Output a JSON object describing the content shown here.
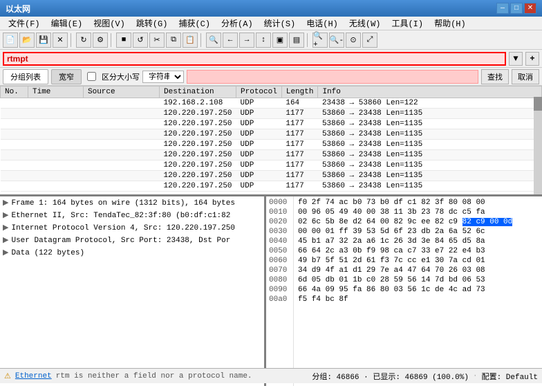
{
  "title": "以太网",
  "titlebar": {
    "title": "以太网",
    "minimize": "—",
    "maximize": "□",
    "close": "✕"
  },
  "menu": {
    "items": [
      "文件(F)",
      "编辑(E)",
      "视图(V)",
      "跳转(G)",
      "捕获(C)",
      "分析(A)",
      "统计(S)",
      "电话(H)",
      "无线(W)",
      "工具(I)",
      "帮助(H)"
    ]
  },
  "filter": {
    "value": "rtmpt",
    "placeholder": ""
  },
  "filter_row2": {
    "tab1": "分组列表",
    "tab2": "宽窄",
    "checkbox_label": "区分大小写",
    "select_label": "字符串",
    "search_btn": "查找",
    "cancel_btn": "取消"
  },
  "table": {
    "headers": [
      "No.",
      "Time",
      "Source",
      "Destination",
      "Protocol",
      "Length",
      "Info"
    ],
    "rows": [
      {
        "no": "",
        "time": "",
        "src": "",
        "dst": "192.168.2.108",
        "proto": "UDP",
        "len": "164",
        "info": "23438 → 53860  Len=122"
      },
      {
        "no": "",
        "time": "",
        "src": "",
        "dst": "120.220.197.250",
        "proto": "UDP",
        "len": "1177",
        "info": "53860 → 23438  Len=1135"
      },
      {
        "no": "",
        "time": "",
        "src": "",
        "dst": "120.220.197.250",
        "proto": "UDP",
        "len": "1177",
        "info": "53860 → 23438  Len=1135"
      },
      {
        "no": "",
        "time": "",
        "src": "",
        "dst": "120.220.197.250",
        "proto": "UDP",
        "len": "1177",
        "info": "53860 → 23438  Len=1135"
      },
      {
        "no": "",
        "time": "",
        "src": "",
        "dst": "120.220.197.250",
        "proto": "UDP",
        "len": "1177",
        "info": "53860 → 23438  Len=1135"
      },
      {
        "no": "",
        "time": "",
        "src": "",
        "dst": "120.220.197.250",
        "proto": "UDP",
        "len": "1177",
        "info": "53860 → 23438  Len=1135"
      },
      {
        "no": "",
        "time": "",
        "src": "",
        "dst": "120.220.197.250",
        "proto": "UDP",
        "len": "1177",
        "info": "53860 → 23438  Len=1135"
      },
      {
        "no": "",
        "time": "",
        "src": "",
        "dst": "120.220.197.250",
        "proto": "UDP",
        "len": "1177",
        "info": "53860 → 23438  Len=1135"
      },
      {
        "no": "",
        "time": "",
        "src": "",
        "dst": "120.220.197.250",
        "proto": "UDP",
        "len": "1177",
        "info": "53860 → 23438  Len=1135"
      }
    ]
  },
  "detail": {
    "items": [
      {
        "text": "Frame 1: 164 bytes on wire (1312 bits), 164 bytes",
        "arrow": "▶",
        "expandable": true
      },
      {
        "text": "Ethernet II, Src: TendaTec_82:3f:80 (b0:df:c1:82",
        "arrow": "▶",
        "expandable": true
      },
      {
        "text": "Internet Protocol Version 4, Src: 120.220.197.250",
        "arrow": "▶",
        "expandable": true
      },
      {
        "text": "User Datagram Protocol, Src Port: 23438, Dst Por",
        "arrow": "▶",
        "expandable": true
      },
      {
        "text": "Data (122 bytes)",
        "arrow": "▶",
        "expandable": true
      }
    ]
  },
  "hex": {
    "offsets": [
      "0000",
      "0010",
      "0020",
      "0030",
      "0040",
      "0050",
      "0060",
      "0070",
      "0080",
      "0090",
      "00a0"
    ],
    "rows": [
      {
        "bytes": "f0 2f 74 ac b0 73 b0 df  c1 82 3f 80 08 00",
        "highlight": false
      },
      {
        "bytes": "00 96 05 49 40 00 38 11  3b 23 78 dc c5 fa",
        "highlight": false
      },
      {
        "bytes": "02 6c 5b 8e d2 64 00 82  9c ee 82 c9 00 0d",
        "highlight": true,
        "highlight_start": 10
      },
      {
        "bytes": "00 00 01 ff 39 53 5d 6f  23 db 2a 6a 52 6c",
        "highlight": false
      },
      {
        "bytes": "45 b1 a7 32 2a a6 1c 26  3d 3e 84 65 d5 8a",
        "highlight": false
      },
      {
        "bytes": "66 64 2c a3 0b f9 98 ca  c7 33 e7 22 e4 b3",
        "highlight": false
      },
      {
        "bytes": "49 b7 5f 51 2d 61 f3 7c  cc e1 30 7a cd 01",
        "highlight": false
      },
      {
        "bytes": "34 d9 4f a1 d1 29 7e a4  47 64 70 26 03 08",
        "highlight": false
      },
      {
        "bytes": "6d 05 db 01 1b c0 28 59  56 14 7d bd 06 53",
        "highlight": false
      },
      {
        "bytes": "66 4a 09 95 fa 86 80 03  56 1c de 4c ad 73",
        "highlight": false
      },
      {
        "bytes": "f5 f4 bc 8f",
        "highlight": false
      }
    ]
  },
  "status": {
    "ethernet_label": "Ethernet",
    "warning_text": "rtm is neither a field nor a protocol name.",
    "stats": "分组: 46866 · 已显示: 46869 (100.0%)",
    "profile": "配置: Default"
  }
}
